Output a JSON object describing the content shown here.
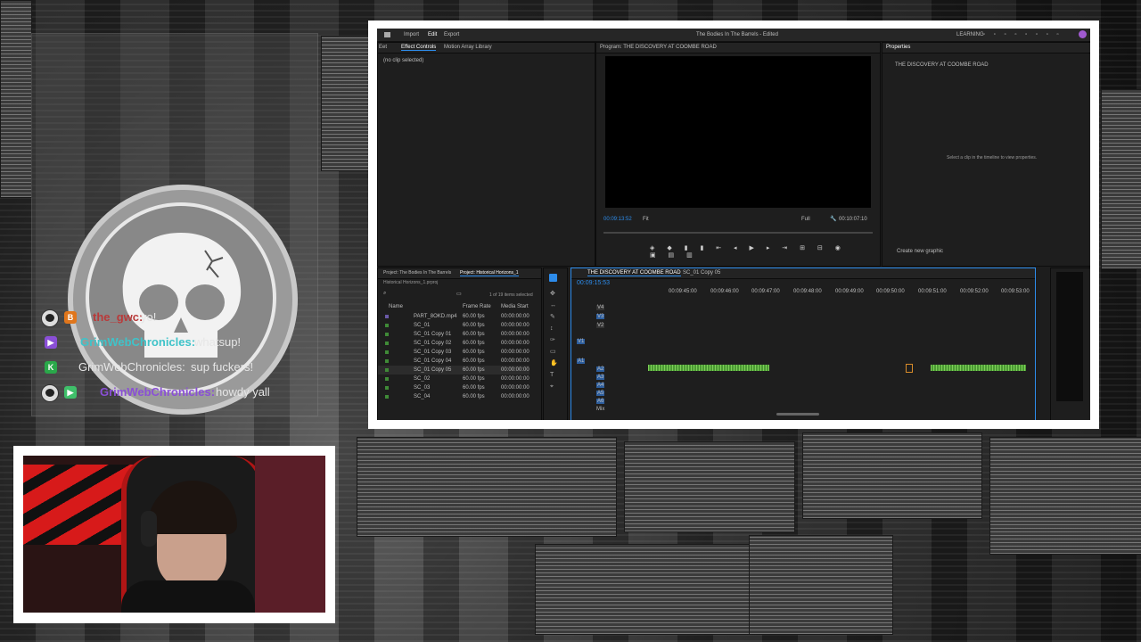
{
  "colors": {
    "accent_blue": "#2d8ceb",
    "audio_green": "#4a9a33",
    "chat_name_red": "#b93a3a",
    "chat_name_teal": "#3fc3c9",
    "chat_name_purple": "#8a4fd6"
  },
  "premiere": {
    "window_title": "The Bodies In The Barrels - Edited",
    "menu": [
      "Import",
      "Edit",
      "Export"
    ],
    "learning": "LEARNING",
    "effect_tabs": [
      "Effect Controls",
      "Motion Array Library"
    ],
    "effect_tab_cut": "Eet",
    "no_clip": "(no clip selected)",
    "program_title": "Program: THE DISCOVERY AT COOMBE ROAD",
    "program_timecode": "00:09:13:52",
    "program_fit": "Fit",
    "program_full": "Full",
    "program_duration": "00:10:07:10",
    "properties_title": "Properties",
    "properties_sequence": "THE DISCOVERY AT COOMBE ROAD",
    "properties_hint": "Select a clip in the timeline to view properties.",
    "create_graphic": "Create new graphic",
    "project_tabs": [
      "Project: The Bodies In The Barrels",
      "Project: Historical Horizons_1"
    ],
    "project_file": "Historical Horizons_1.prproj",
    "items_selected": "1 of 19 items selected",
    "columns": [
      "Name",
      "Frame Rate",
      "Media Start"
    ],
    "rows": [
      {
        "name": "PART_8OKD.mp4",
        "rate": "60.00 fps",
        "start": "00:00:00:00"
      },
      {
        "name": "SC_01",
        "rate": "60.00 fps",
        "start": "00:00:00:00"
      },
      {
        "name": "SC_01 Copy 01",
        "rate": "60.00 fps",
        "start": "00:00:00:00"
      },
      {
        "name": "SC_01 Copy 02",
        "rate": "60.00 fps",
        "start": "00:00:00:00"
      },
      {
        "name": "SC_01 Copy 03",
        "rate": "60.00 fps",
        "start": "00:00:00:00"
      },
      {
        "name": "SC_01 Copy 04",
        "rate": "60.00 fps",
        "start": "00:00:00:00"
      },
      {
        "name": "SC_01 Copy 05",
        "rate": "60.00 fps",
        "start": "00:00:00:00"
      },
      {
        "name": "SC_02",
        "rate": "60.00 fps",
        "start": "00:00:00:00"
      },
      {
        "name": "SC_03",
        "rate": "60.00 fps",
        "start": "00:00:00:00"
      },
      {
        "name": "SC_04",
        "rate": "60.00 fps",
        "start": "00:00:00:00"
      }
    ],
    "timeline_tabs": [
      "THE DISCOVERY AT COOMBE ROAD",
      "SC_01 Copy 05"
    ],
    "timeline_timecode": "00:09:15:53",
    "ruler": [
      "00:09:45:00",
      "00:09:46:00",
      "00:09:47:00",
      "00:09:48:00",
      "00:09:49:00",
      "00:09:50:00",
      "00:09:51:00",
      "00:09:52:00",
      "00:09:53:00"
    ],
    "video_tracks": [
      "V4",
      "V3",
      "V2",
      "V1"
    ],
    "audio_tracks": [
      "A1",
      "A2",
      "A3",
      "A4",
      "A5",
      "A6"
    ],
    "mix_label": "Mix"
  },
  "chat": {
    "lines": [
      {
        "user": "the_gwc:",
        "message": "yo!",
        "badge": "B"
      },
      {
        "user": "GrimWebChronicles:",
        "message": "whatsup!",
        "badge": "▶"
      },
      {
        "user": "GrimWebChronicles:",
        "message": "sup fuckers!",
        "badge": "K"
      },
      {
        "user": "GrimWebChronicles:",
        "message": "howdy yall",
        "badge": "▶"
      }
    ]
  },
  "icons": [
    "skull-logo-icon",
    "arrow-select-icon",
    "play-icon",
    "wrench-icon",
    "search-icon",
    "folder-icon"
  ]
}
